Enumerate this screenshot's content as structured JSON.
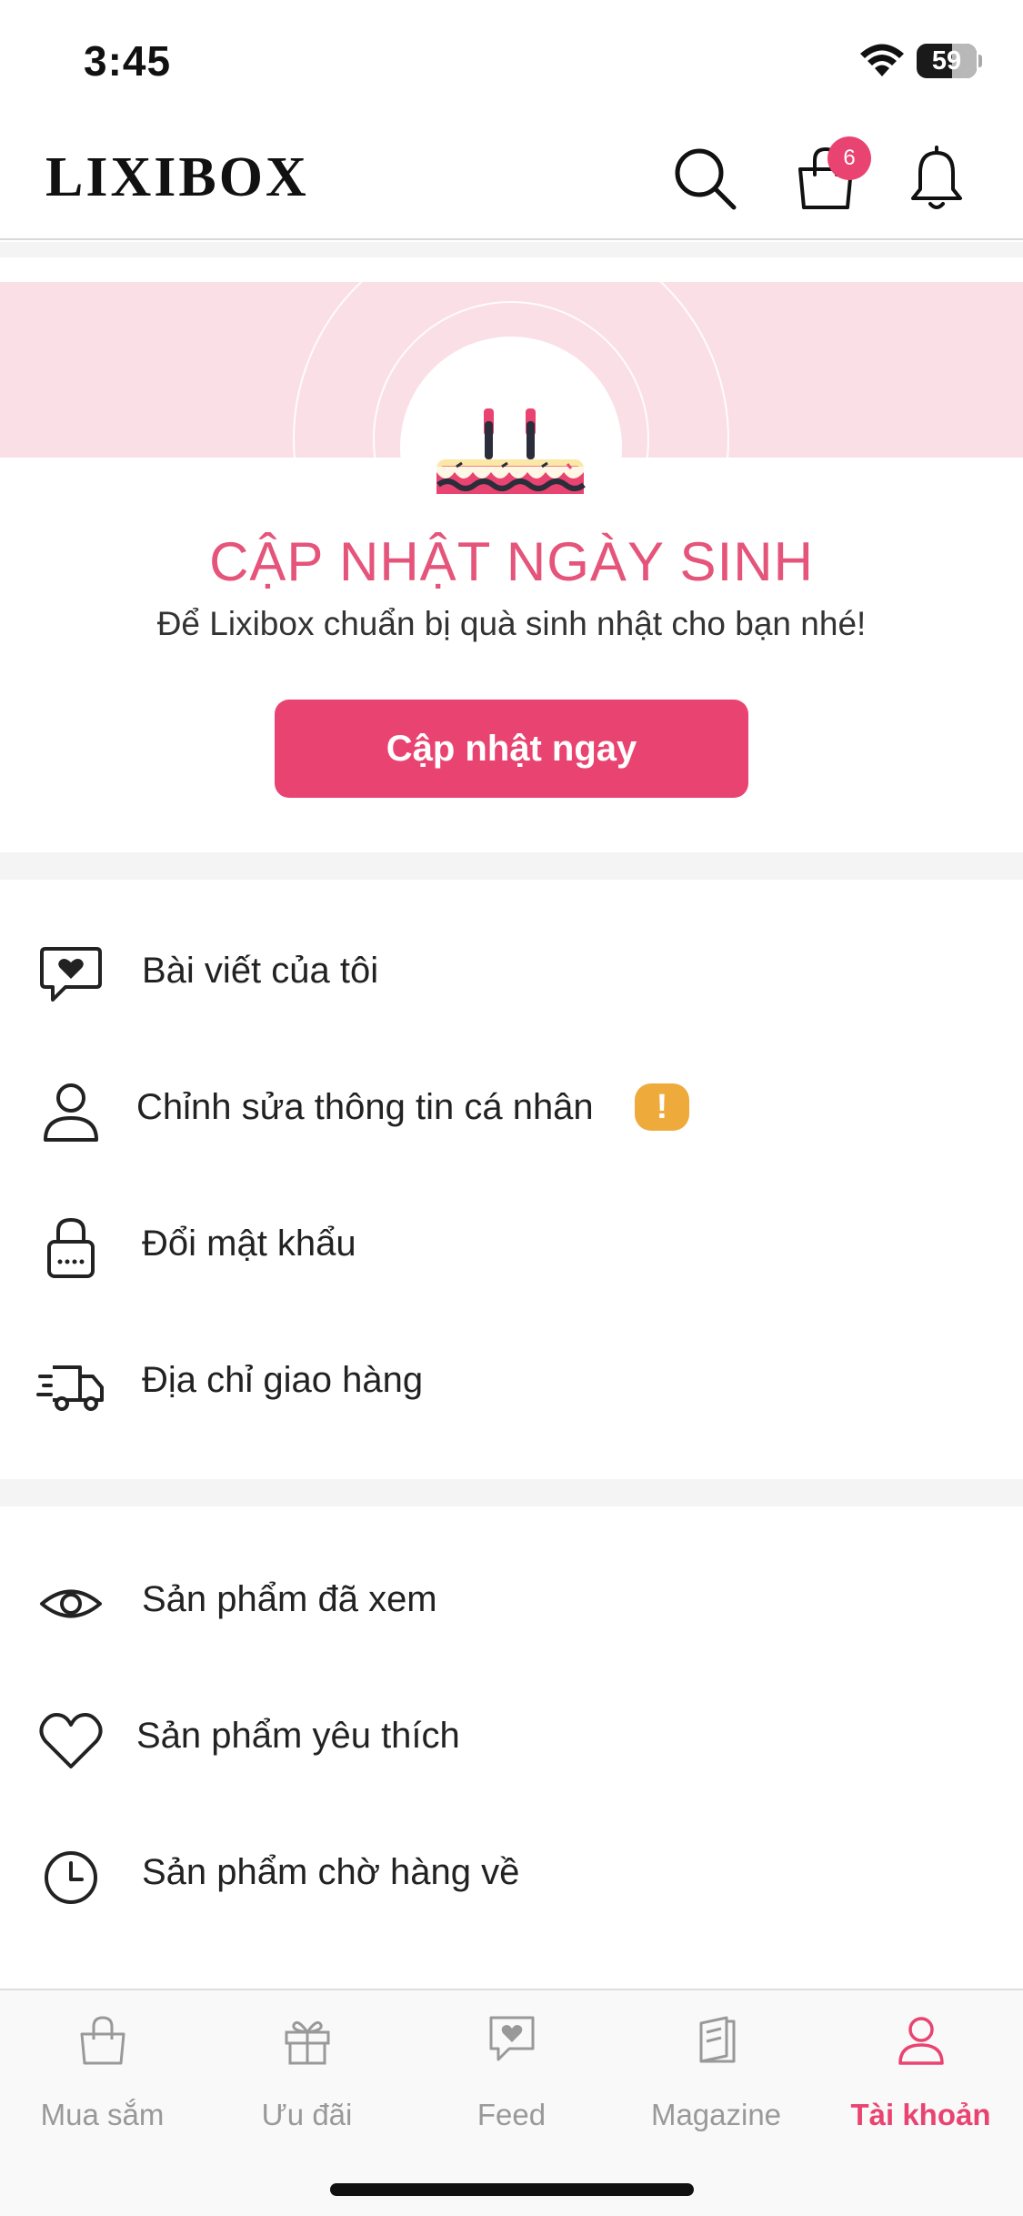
{
  "status_bar": {
    "time": "3:45",
    "battery_level": "59"
  },
  "header": {
    "logo": "LIXIBOX",
    "cart_count": "6"
  },
  "birthday": {
    "title": "CẬP NHẬT NGÀY SINH",
    "subtitle": "Để Lixibox chuẩn bị quà sinh nhật cho bạn nhé!",
    "button_label": "Cập nhật ngay"
  },
  "menu_group_1": [
    {
      "label": "Bài viết của tôi",
      "icon": "chat-heart-icon"
    },
    {
      "label": "Chỉnh sửa thông tin cá nhân",
      "icon": "user-icon",
      "badge": "!"
    },
    {
      "label": "Đổi mật khẩu",
      "icon": "lock-icon"
    },
    {
      "label": "Địa chỉ giao hàng",
      "icon": "truck-icon"
    }
  ],
  "menu_group_2": [
    {
      "label": "Sản phẩm đã xem",
      "icon": "eye-icon"
    },
    {
      "label": "Sản phẩm yêu thích",
      "icon": "heart-icon"
    },
    {
      "label": "Sản phẩm chờ hàng về",
      "icon": "clock-icon"
    }
  ],
  "tab_bar": {
    "tabs": [
      {
        "label": "Mua sắm",
        "icon": "shopping-bag-icon"
      },
      {
        "label": "Ưu đãi",
        "icon": "gift-icon"
      },
      {
        "label": "Feed",
        "icon": "chat-heart-icon"
      },
      {
        "label": "Magazine",
        "icon": "magazine-icon"
      },
      {
        "label": "Tài khoản",
        "icon": "user-icon",
        "active": true
      }
    ]
  },
  "colors": {
    "accent": "#e94471",
    "title_pink": "#e5547a",
    "banner_pink": "#fae0e6",
    "warning": "#eeab3c",
    "inactive": "#999999"
  }
}
